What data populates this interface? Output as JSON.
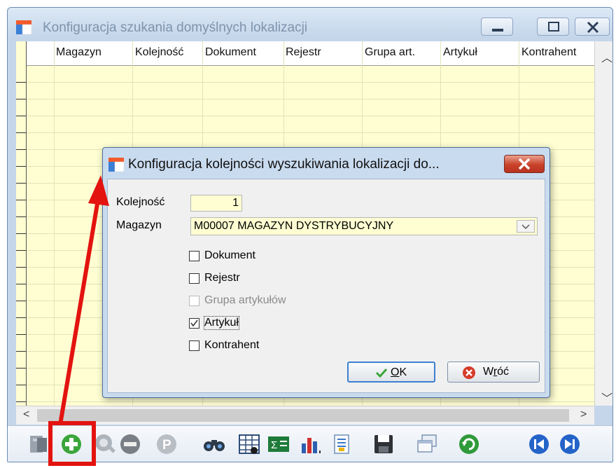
{
  "main_window": {
    "title": "Konfiguracja szukania domyślnych lokalizacji",
    "columns": [
      "Magazyn",
      "Kolejność",
      "Dokument",
      "Rejestr",
      "Grupa art.",
      "Artykuł",
      "Kontrahent"
    ]
  },
  "dialog": {
    "title": "Konfiguracja kolejności wyszukiwania lokalizacji do...",
    "kolejnosc_label": "Kolejność",
    "kolejnosc_value": "1",
    "magazyn_label": "Magazyn",
    "magazyn_value": "M00007 MAGAZYN DYSTRYBUCYJNY",
    "checkboxes": [
      {
        "label": "Dokument",
        "checked": false,
        "enabled": true
      },
      {
        "label": "Rejestr",
        "checked": false,
        "enabled": true
      },
      {
        "label": "Grupa artykułów",
        "checked": false,
        "enabled": false
      },
      {
        "label": "Artykuł",
        "checked": true,
        "enabled": true
      },
      {
        "label": "Kontrahent",
        "checked": false,
        "enabled": true
      }
    ],
    "ok_prefix": "",
    "ok_underlined": "O",
    "ok_rest": "K",
    "back_prefix": "W",
    "back_underlined": "r",
    "back_rest": "óć"
  },
  "toolbar_icons": [
    "exit-icon",
    "add-icon",
    "search-record-icon",
    "delete-icon",
    "print-icon",
    "binoculars-icon",
    "grid-view-icon",
    "sum-icon",
    "chart-icon",
    "export-icon",
    "save-icon",
    "windows-icon",
    "refresh-icon",
    "first-record-icon",
    "last-record-icon"
  ],
  "colors": {
    "highlight": "#e3130f",
    "grid_background": "#fefed2",
    "add_icon": "#3aa63a",
    "nav_icon": "#2464c8"
  }
}
